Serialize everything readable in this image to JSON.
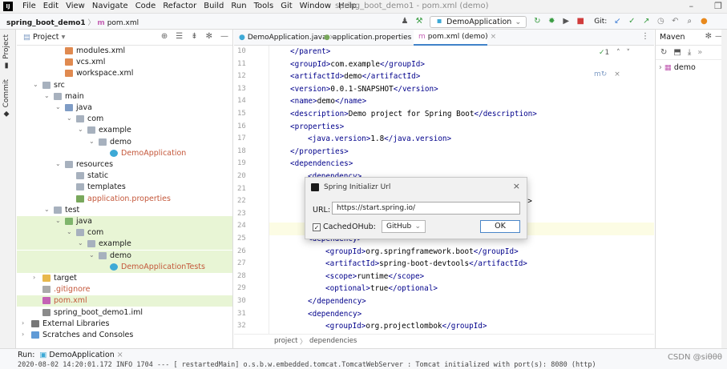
{
  "menu": [
    "File",
    "Edit",
    "View",
    "Navigate",
    "Code",
    "Refactor",
    "Build",
    "Run",
    "Tools",
    "Git",
    "Window",
    "Help"
  ],
  "window_title": "spring_boot_demo1 - pom.xml (demo)",
  "breadcrumb": {
    "project": "spring_boot_demo1",
    "file": "pom.xml"
  },
  "run_config": "DemoApplication",
  "git_label": "Git:",
  "project_panel": {
    "title": "Project"
  },
  "tree": [
    {
      "label": "modules.xml",
      "icon": "xml",
      "depth": 3,
      "arrow": ""
    },
    {
      "label": "vcs.xml",
      "icon": "xml",
      "depth": 3,
      "arrow": ""
    },
    {
      "label": "workspace.xml",
      "icon": "xml",
      "depth": 3,
      "arrow": ""
    },
    {
      "label": "src",
      "icon": "folder",
      "depth": 1,
      "arrow": "v"
    },
    {
      "label": "main",
      "icon": "folder",
      "depth": 2,
      "arrow": "v"
    },
    {
      "label": "java",
      "icon": "src",
      "depth": 3,
      "arrow": "v"
    },
    {
      "label": "com",
      "icon": "folder",
      "depth": 4,
      "arrow": "v"
    },
    {
      "label": "example",
      "icon": "folder",
      "depth": 5,
      "arrow": "v"
    },
    {
      "label": "demo",
      "icon": "folder",
      "depth": 6,
      "arrow": "v"
    },
    {
      "label": "DemoApplication",
      "icon": "class",
      "depth": 7,
      "arrow": "",
      "color": "red"
    },
    {
      "label": "resources",
      "icon": "res",
      "depth": 3,
      "arrow": "v"
    },
    {
      "label": "static",
      "icon": "folder",
      "depth": 4,
      "arrow": ""
    },
    {
      "label": "templates",
      "icon": "folder",
      "depth": 4,
      "arrow": ""
    },
    {
      "label": "application.properties",
      "icon": "prop",
      "depth": 4,
      "arrow": "",
      "color": "red"
    },
    {
      "label": "test",
      "icon": "folder",
      "depth": 2,
      "arrow": "v"
    },
    {
      "label": "java",
      "icon": "tst",
      "depth": 3,
      "arrow": "v",
      "sel": true
    },
    {
      "label": "com",
      "icon": "folder",
      "depth": 4,
      "arrow": "v",
      "sel": true
    },
    {
      "label": "example",
      "icon": "folder",
      "depth": 5,
      "arrow": "v",
      "sel": true
    },
    {
      "label": "demo",
      "icon": "folder",
      "depth": 6,
      "arrow": "v",
      "sel": true
    },
    {
      "label": "DemoApplicationTests",
      "icon": "class",
      "depth": 7,
      "arrow": "",
      "color": "red",
      "sel": true
    },
    {
      "label": "target",
      "icon": "tgt",
      "depth": 1,
      "arrow": ">"
    },
    {
      "label": ".gitignore",
      "icon": "git",
      "depth": 1,
      "arrow": "",
      "color": "red"
    },
    {
      "label": "pom.xml",
      "icon": "pom",
      "depth": 1,
      "arrow": "",
      "color": "red",
      "sel": true
    },
    {
      "label": "spring_boot_demo1.iml",
      "icon": "iml",
      "depth": 1,
      "arrow": ""
    },
    {
      "label": "External Libraries",
      "icon": "lib",
      "depth": 0,
      "arrow": ">"
    },
    {
      "label": "Scratches and Consoles",
      "icon": "scr",
      "depth": 0,
      "arrow": ">"
    }
  ],
  "tabs": [
    {
      "label": "DemoApplication.java",
      "active": false
    },
    {
      "label": "application.properties",
      "active": false
    },
    {
      "label": "pom.xml (demo)",
      "active": true
    }
  ],
  "code_lines": [
    {
      "n": "10",
      "indent": 1,
      "html": "&lt;/parent&gt;",
      "mode": "tag"
    },
    {
      "n": "11",
      "indent": 1,
      "text": "<groupId>com.example</groupId>"
    },
    {
      "n": "12",
      "indent": 1,
      "text": "<artifactId>demo</artifactId>"
    },
    {
      "n": "13",
      "indent": 1,
      "text": "<version>0.0.1-SNAPSHOT</version>"
    },
    {
      "n": "14",
      "indent": 1,
      "text": "<name>demo</name>"
    },
    {
      "n": "15",
      "indent": 1,
      "text": "<description>Demo project for Spring Boot</description>"
    },
    {
      "n": "16",
      "indent": 1,
      "text": "<properties>"
    },
    {
      "n": "17",
      "indent": 2,
      "text": "<java.version>1.8</java.version>"
    },
    {
      "n": "18",
      "indent": 1,
      "text": "</properties>"
    },
    {
      "n": "19",
      "indent": 1,
      "text": "<dependencies>"
    },
    {
      "n": "20",
      "indent": 2,
      "text": "<dependency>"
    },
    {
      "n": "21",
      "indent": 2,
      "text": ""
    },
    {
      "n": "22",
      "indent": 2,
      "text": "                                               Id>"
    },
    {
      "n": "23",
      "indent": 2,
      "text": ""
    },
    {
      "n": "24",
      "indent": 2,
      "text": ""
    },
    {
      "n": "25",
      "indent": 2,
      "text": "<dependency>"
    },
    {
      "n": "26",
      "indent": 3,
      "text": "<groupId>org.springframework.boot</groupId>"
    },
    {
      "n": "27",
      "indent": 3,
      "text": "<artifactId>spring-boot-devtools</artifactId>"
    },
    {
      "n": "28",
      "indent": 3,
      "text": "<scope>runtime</scope>"
    },
    {
      "n": "29",
      "indent": 3,
      "text": "<optional>true</optional>"
    },
    {
      "n": "30",
      "indent": 2,
      "text": "</dependency>"
    },
    {
      "n": "31",
      "indent": 2,
      "text": "<dependency>"
    },
    {
      "n": "32",
      "indent": 3,
      "text": "<groupId>org.projectlombok</groupId>"
    }
  ],
  "inspection_count": "1",
  "editor_breadcrumb": [
    "project",
    "dependencies"
  ],
  "maven": {
    "title": "Maven",
    "item": "demo"
  },
  "run": {
    "label": "Run:",
    "config": "DemoApplication",
    "log": "2020-08-02 14:20:01.172  INFO 1704 ---  [  restartedMain] o.s.b.w.embedded.tomcat.TomcatWebServer  : Tomcat initialized with port(s): 8080 (http)"
  },
  "watermark": "CSDN @siθθθ",
  "dialog": {
    "title": "Spring Initializr Url",
    "url_label": "URL:",
    "url": "https://start.spring.io/",
    "cached_label": "Cached",
    "ohub_label": "OHub:",
    "ohub_value": "GitHub",
    "ok": "OK"
  }
}
